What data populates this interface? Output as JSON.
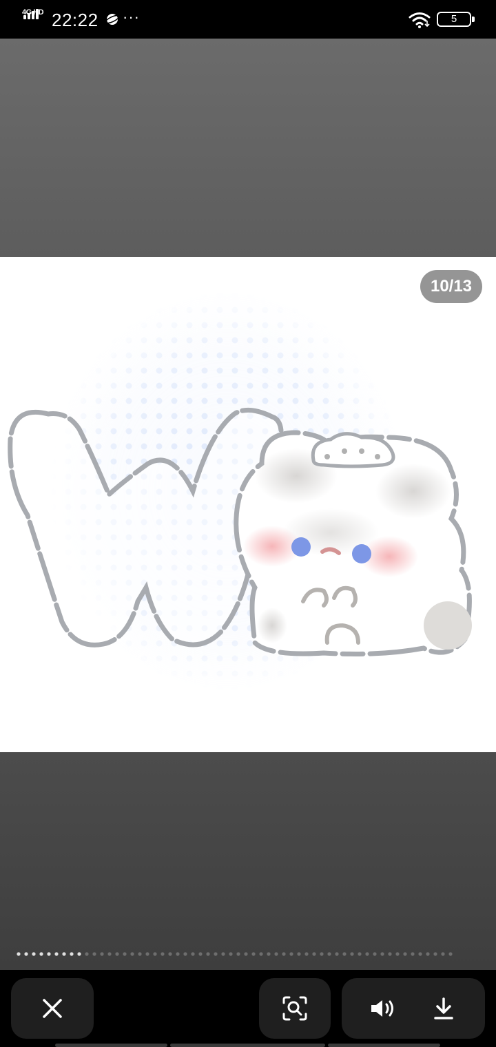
{
  "status_bar": {
    "network": "4G HD",
    "time": "22:22",
    "more": "···",
    "battery": "5"
  },
  "viewer": {
    "page_counter": "10/13",
    "current_page": 10,
    "total_pages": 13,
    "image": {
      "description_icon": "bunny-with-letter-w-sticker"
    }
  },
  "toolbar": {
    "close_icon": "close-icon",
    "lens_icon": "image-search-icon",
    "sound_icon": "speaker-icon",
    "download_icon": "download-icon"
  },
  "colors": {
    "top_panel": "#6b6b6b",
    "bottom_panel": "#4c4c4c",
    "toolbar_bg": "#000000",
    "button_bg": "#1f1f1f",
    "counter_bg": "#828282",
    "outline": "#a8abb0",
    "dot_blue": "#dbe6fb"
  }
}
